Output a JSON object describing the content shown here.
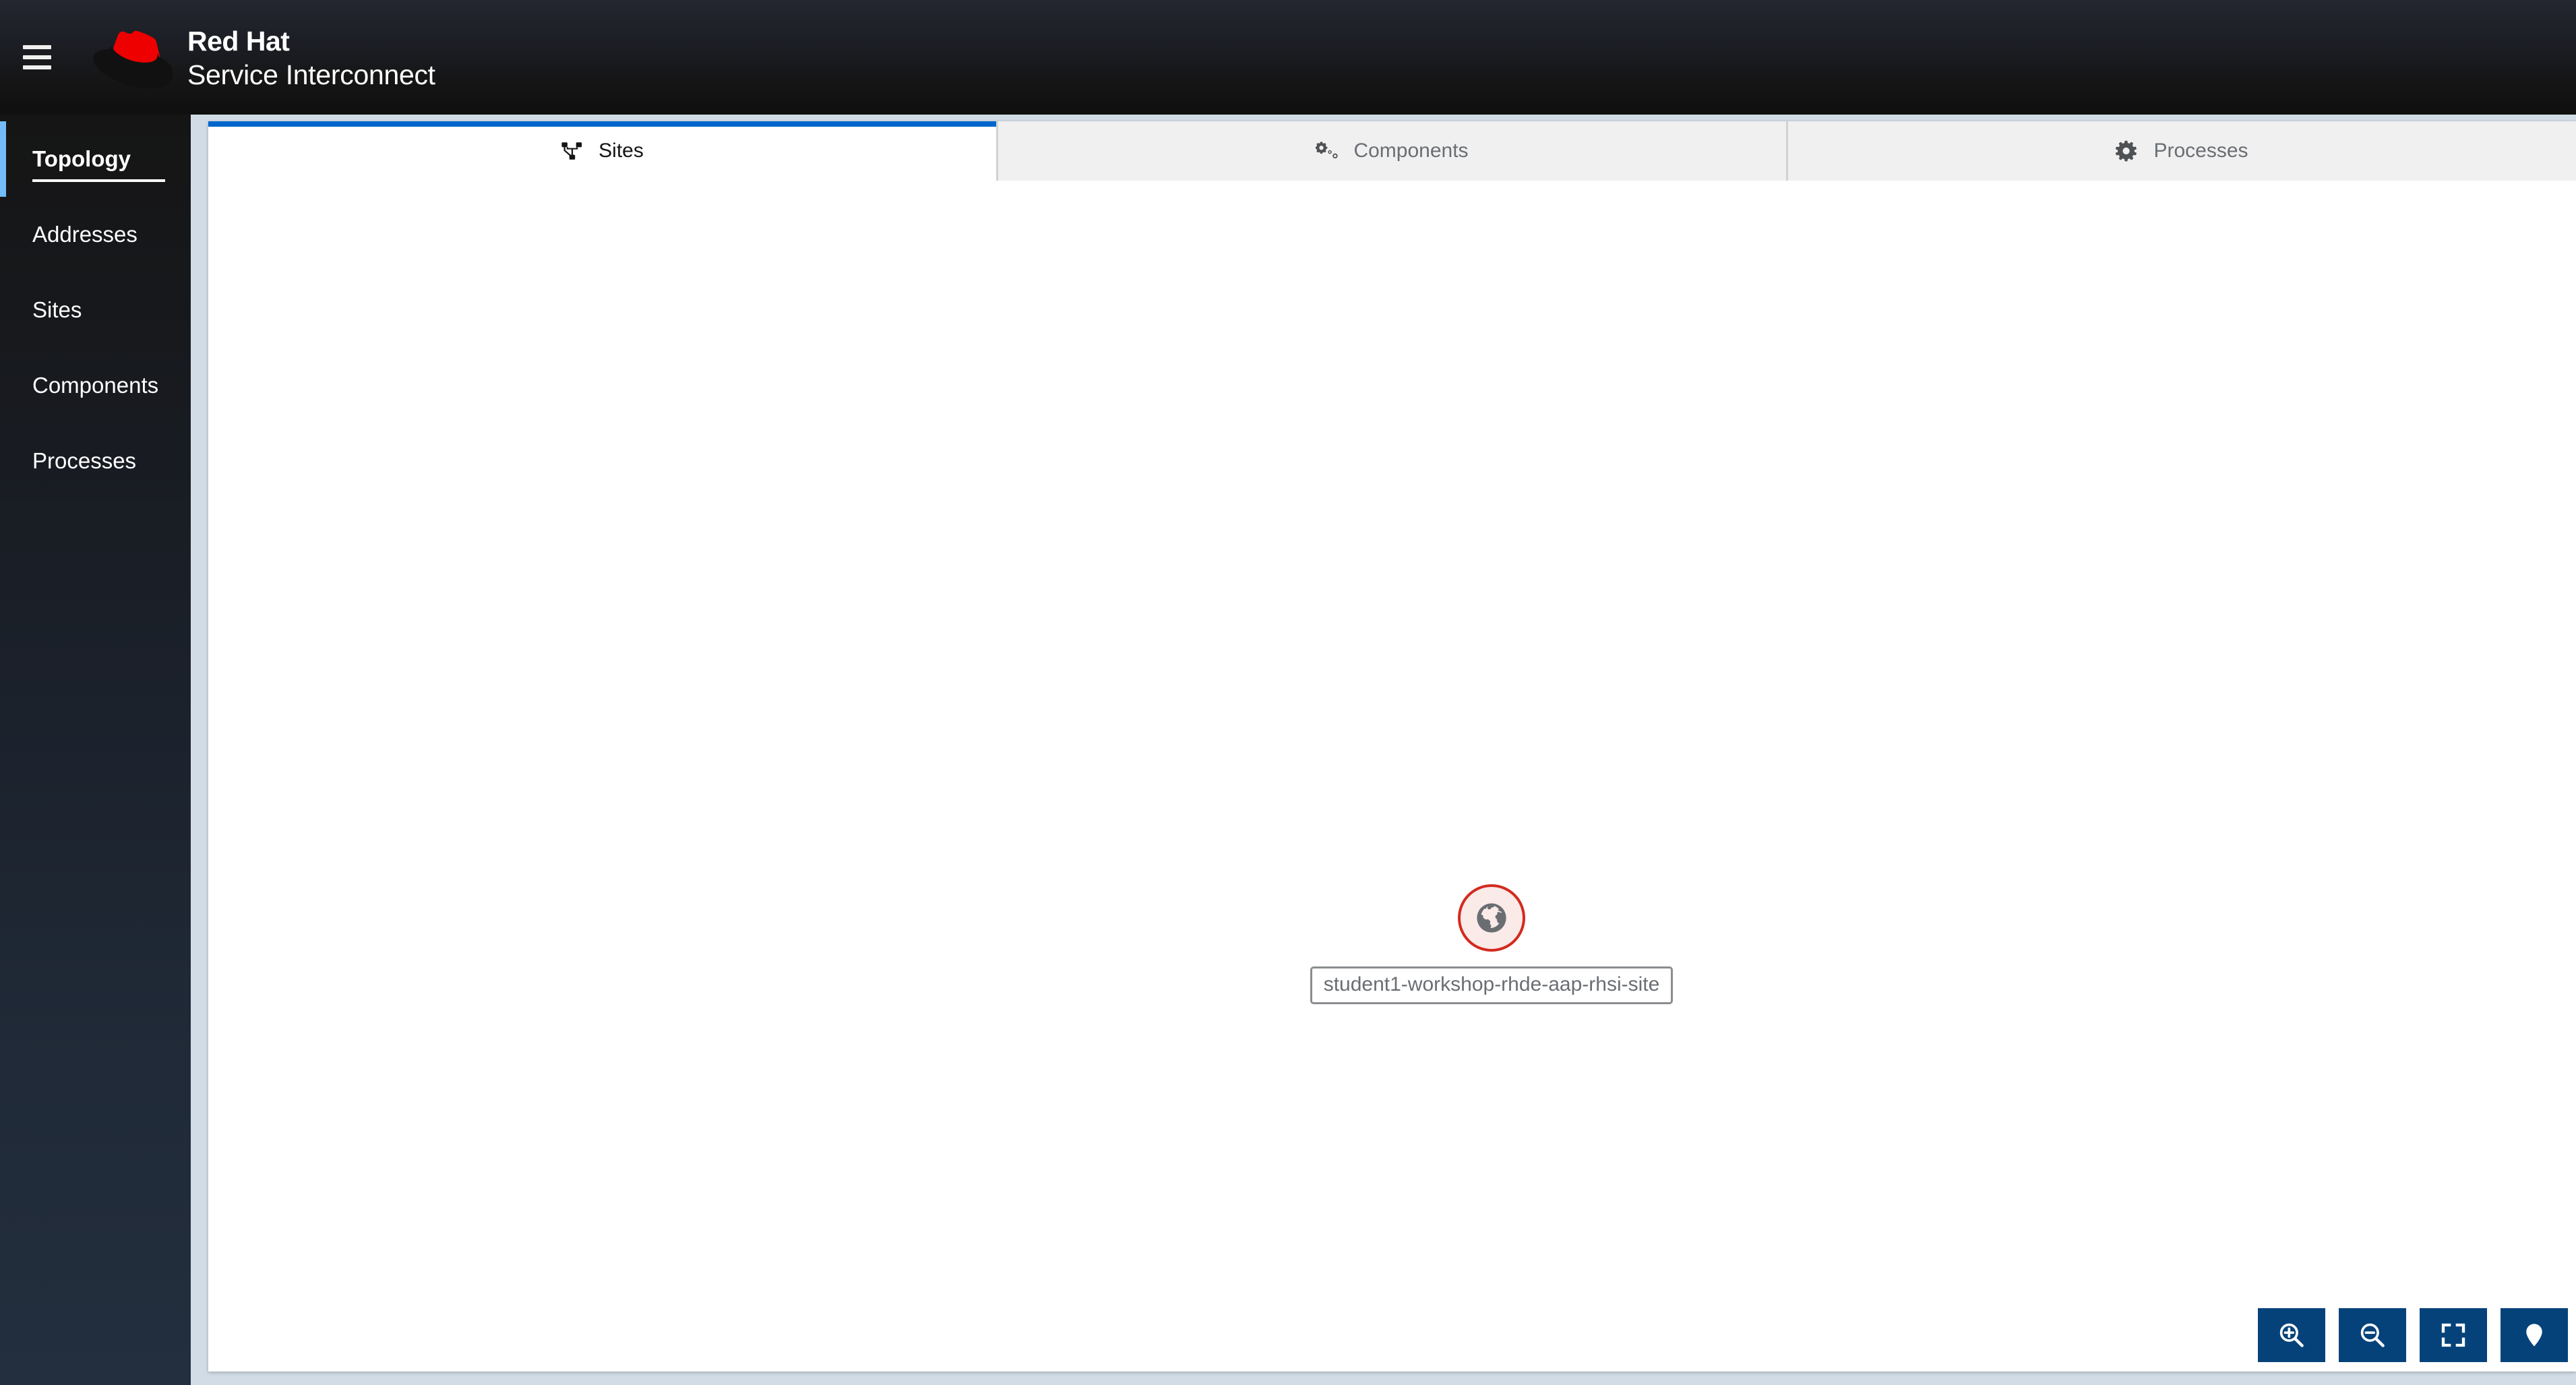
{
  "masthead": {
    "menu_icon": "hamburger-menu-icon",
    "logo_icon": "red-hat-logo-icon",
    "brand_line1": "Red Hat",
    "brand_line2": "Service Interconnect",
    "brand_color": "#ee0000"
  },
  "sidebar": {
    "active_indicator_color": "#73bcf7",
    "items": [
      {
        "label": "Topology",
        "name": "sidebar-item-topology",
        "active": true
      },
      {
        "label": "Addresses",
        "name": "sidebar-item-addresses",
        "active": false
      },
      {
        "label": "Sites",
        "name": "sidebar-item-sites",
        "active": false
      },
      {
        "label": "Components",
        "name": "sidebar-item-components",
        "active": false
      },
      {
        "label": "Processes",
        "name": "sidebar-item-processes",
        "active": false
      }
    ]
  },
  "tabs": {
    "active_border_color": "#0066cc",
    "items": [
      {
        "label": "Sites",
        "icon": "sitemap-icon",
        "active": true
      },
      {
        "label": "Components",
        "icon": "cogs-icon",
        "active": false
      },
      {
        "label": "Processes",
        "icon": "cog-icon",
        "active": false
      }
    ]
  },
  "topology": {
    "nodes": [
      {
        "label": "student1-workshop-rhde-aap-rhsi-site",
        "icon": "globe-icon",
        "fill_color": "#faeae8",
        "border_color": "#d42a20"
      }
    ]
  },
  "controls": {
    "button_color": "#06427a",
    "items": [
      {
        "label": "Zoom in",
        "icon": "zoom-in-icon"
      },
      {
        "label": "Zoom out",
        "icon": "zoom-out-icon"
      },
      {
        "label": "Fit to screen",
        "icon": "expand-icon"
      },
      {
        "label": "Reset view",
        "icon": "map-pin-icon"
      }
    ]
  }
}
